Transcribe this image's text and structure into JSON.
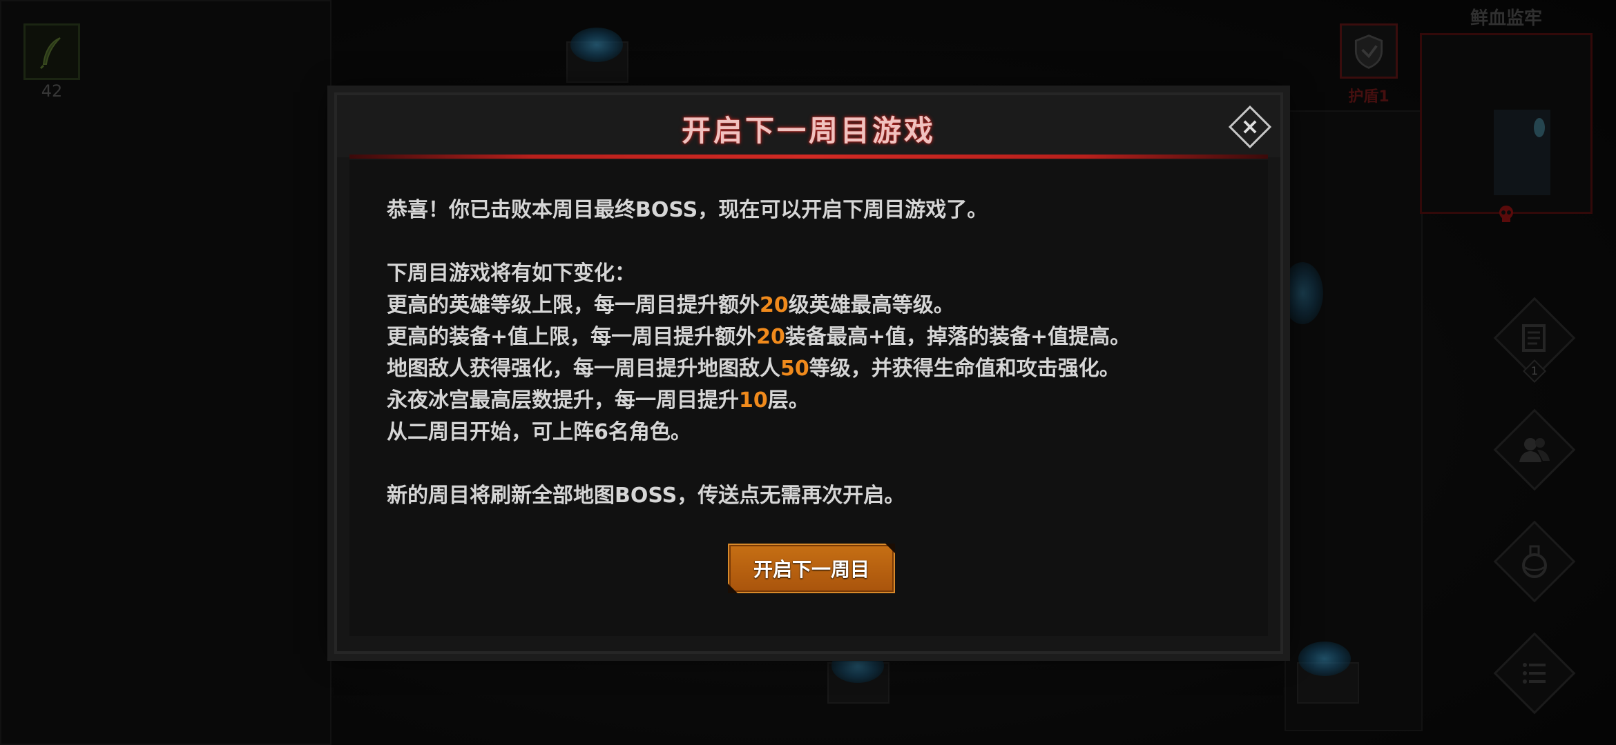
{
  "hud": {
    "item_count": "42",
    "shield_label": "护盾1",
    "map_title": "鲜血监牢",
    "quest_badge": "1"
  },
  "dialog": {
    "title": "开启下一周目游戏",
    "lines": {
      "intro": "恭喜！你已击败本周目最终BOSS，现在可以开启下周目游戏了。",
      "changes_header": "下周目游戏将有如下变化：",
      "c1_a": "更高的英雄等级上限，每一周目提升额外",
      "c1_num": "20",
      "c1_b": "级英雄最高等级。",
      "c2_a": "更高的装备+值上限，每一周目提升额外",
      "c2_num": "20",
      "c2_b": "装备最高+值，掉落的装备+值提高。",
      "c3_a": "地图敌人获得强化，每一周目提升地图敌人",
      "c3_num": "50",
      "c3_b": "等级，并获得生命值和攻击强化。",
      "c4_a": "永夜冰宫最高层数提升，每一周目提升",
      "c4_num": "10",
      "c4_b": "层。",
      "c5": "从二周目开始，可上阵6名角色。",
      "footer": "新的周目将刷新全部地图BOSS，传送点无需再次开启。"
    },
    "confirm_label": "开启下一周目",
    "close_symbol": "×"
  },
  "colors": {
    "title": "#f0c2bf",
    "title_glow": "#b5201c",
    "highlight": "#f08a1c",
    "button": "#c66f14"
  },
  "icons": [
    "feather-icon",
    "shield-icon",
    "skull-icon",
    "scroll-icon",
    "party-icon",
    "potion-icon",
    "menu-list-icon",
    "close-icon"
  ]
}
